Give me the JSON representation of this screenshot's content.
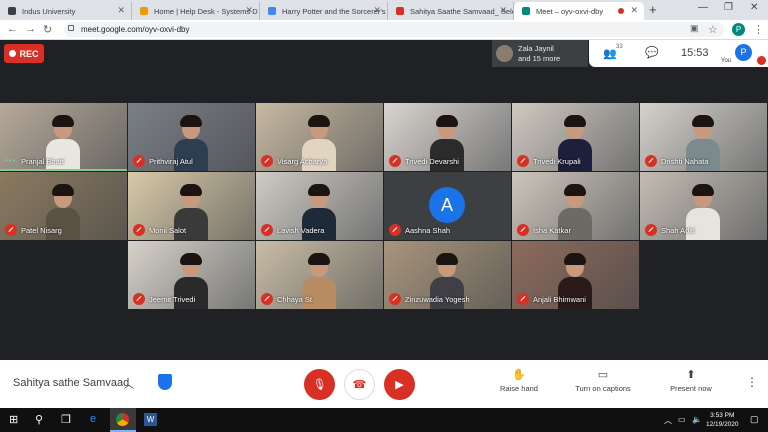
{
  "browser": {
    "tabs": [
      {
        "title": "Indus University",
        "favicon_color": "#3c4043"
      },
      {
        "title": "Home | Help Desk - Systems D",
        "favicon_color": "#f29900"
      },
      {
        "title": "Harry Potter and the Sorcerer's",
        "favicon_color": "#4285f4"
      },
      {
        "title": "Sahitya Saathe Samvaad_ Sele",
        "favicon_color": "#d93025"
      },
      {
        "title": "Meet – oyv-oxvi-dby",
        "favicon_color": "#00897b"
      },
      {
        "title": "",
        "favicon_color": "#d93025"
      }
    ],
    "url": "meet.google.com/oyv-oxvi-dby"
  },
  "meet": {
    "rec_label": "REC",
    "join_notice": {
      "line1": "Zala Jaynil",
      "line2": "and 15 more"
    },
    "participant_count": "33",
    "time": "15:53",
    "you_initial": "P",
    "you_label": "You",
    "participants": [
      {
        "name": "Pranjal Bhatt",
        "muted": false,
        "speaking": true,
        "shirt": "#e9e6e0",
        "bg": "#b6a99a"
      },
      {
        "name": "Prithviraj Atul",
        "muted": true,
        "shirt": "#2c3e50",
        "bg": "#7b7f86"
      },
      {
        "name": "Visarg Acharya",
        "muted": true,
        "shirt": "#e1d5c2",
        "bg": "#c7b8a2"
      },
      {
        "name": "Trivedi Devarshi",
        "muted": true,
        "shirt": "#2b2b2b",
        "bg": "#d9d4cf"
      },
      {
        "name": "Trivedi Krupali",
        "muted": true,
        "shirt": "#1e1f3a",
        "bg": "#cfc9c0"
      },
      {
        "name": "Drishti Nahata",
        "muted": true,
        "shirt": "#7a8a8d",
        "bg": "#d6d2cb"
      },
      {
        "name": "Patel Nisarg",
        "muted": true,
        "shirt": "#5a5144",
        "bg": "#8c7a60"
      },
      {
        "name": "Monil Salot",
        "muted": true,
        "shirt": "#3a3a3a",
        "bg": "#d8c9a8"
      },
      {
        "name": "Lavish Vadera",
        "muted": true,
        "shirt": "#1f2a38",
        "bg": "#cfcbc4"
      },
      {
        "name": "Aashna Shah",
        "muted": true,
        "initial": "A"
      },
      {
        "name": "Isha Katkar",
        "muted": true,
        "shirt": "#6d6a66",
        "bg": "#cdc5bb"
      },
      {
        "name": "Shah Aditi",
        "muted": true,
        "shirt": "#e7e4df",
        "bg": "#c3bcb3"
      },
      {
        "name": "Jeemit Trivedi",
        "muted": true,
        "shirt": "#2a2a2a",
        "bg": "#d7d2c9"
      },
      {
        "name": "Chhaya St.",
        "muted": true,
        "shirt": "#b78c63",
        "bg": "#c9bda6"
      },
      {
        "name": "Zinzuwadia Yogesh",
        "muted": true,
        "shirt": "#3f3f46",
        "bg": "#a8957c"
      },
      {
        "name": "Anjali Bhimwani",
        "muted": true,
        "shirt": "#2a1a1a",
        "bg": "#8d6b5c"
      }
    ],
    "meeting_name": "Sahitya sathe Samvaad",
    "controls": {
      "raise_hand": "Raise hand",
      "captions": "Turn on captions",
      "present": "Present now"
    }
  },
  "taskbar": {
    "time": "3:53 PM",
    "date": "12/19/2020"
  }
}
